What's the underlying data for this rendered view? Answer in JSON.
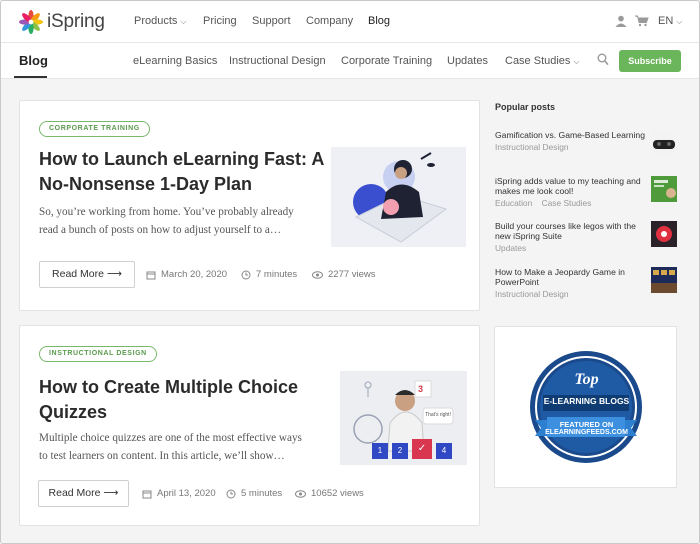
{
  "brand": {
    "name": "iSpring"
  },
  "topnav": {
    "items": [
      {
        "label": "Products",
        "has_dropdown": true
      },
      {
        "label": "Pricing"
      },
      {
        "label": "Support"
      },
      {
        "label": "Company"
      },
      {
        "label": "Blog",
        "active": true
      }
    ],
    "lang": "EN",
    "icons": [
      "user-icon",
      "cart-icon",
      "chevron-down-icon"
    ]
  },
  "subnav": {
    "current": "Blog",
    "items": [
      "eLearning Basics",
      "Instructional Design",
      "Corporate Training",
      "Updates",
      "Case Studies"
    ],
    "subscribe_label": "Subscribe",
    "accent": "#6bb55a"
  },
  "posts": [
    {
      "tag": "CORPORATE TRAINING",
      "title_line1": "How to Launch eLearning Fast: A",
      "title_line2": "No-Nonsense 1-Day Plan",
      "excerpt_line1": "So, you’re working from home. You’ve probably already",
      "excerpt_line2": "read a bunch of posts on how to adjust yourself to a…",
      "read_more": "Read More ⟶",
      "date": "March 20, 2020",
      "read_time": "7 minutes",
      "views": "2277 views"
    },
    {
      "tag": "INSTRUCTIONAL DESIGN",
      "title_line1": "How to Create Multiple Choice",
      "title_line2": "Quizzes",
      "excerpt_line1": "Multiple choice quizzes are one of the most effective ways",
      "excerpt_line2": "to test learners on content. In this article, we’ll show…",
      "read_more": "Read More ⟶",
      "date": "April 13, 2020",
      "read_time": "5 minutes",
      "views": "10652 views",
      "image_text": {
        "bubble": "3",
        "speech": "That's right!",
        "answers": [
          "1",
          "2",
          "✓",
          "4"
        ]
      }
    }
  ],
  "sidebar": {
    "heading": "Popular posts",
    "items": [
      {
        "title": "Gamification vs. Game-Based Learning",
        "cats": [
          "Instructional Design"
        ]
      },
      {
        "title": "iSpring adds value to my teaching and makes me look cool!",
        "cats": [
          "Education",
          "Case Studies"
        ]
      },
      {
        "title": "Build your courses like legos with the new iSpring Suite",
        "cats": [
          "Updates"
        ]
      },
      {
        "title": "How to Make a Jeopardy Game in PowerPoint",
        "cats": [
          "Instructional Design"
        ]
      }
    ],
    "badge": {
      "top": "Top",
      "ribbon": "E-LEARNING BLOGS",
      "featured": "FEATURED ON",
      "site": "ELEARNINGFEEDS.COM"
    }
  }
}
